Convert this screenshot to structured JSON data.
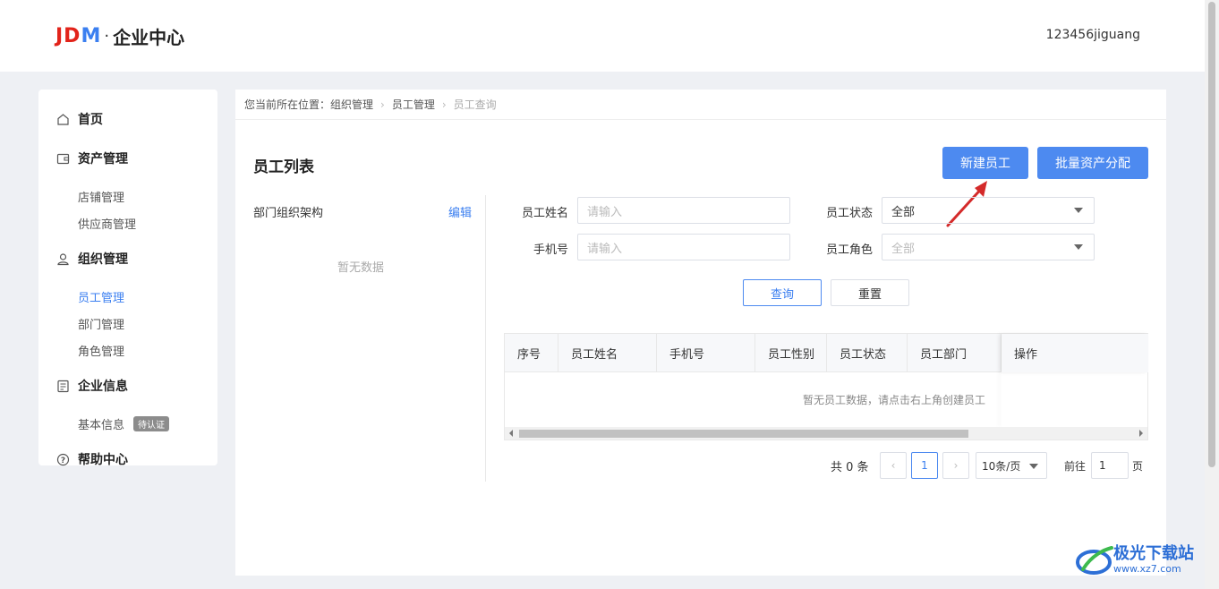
{
  "header": {
    "logo_jd": "JD",
    "logo_m": "M",
    "logo_dot": "·",
    "logo_text": "企业中心",
    "username": "123456jiguang"
  },
  "sidebar": {
    "home": "首页",
    "asset_mgmt": "资产管理",
    "store_mgmt": "店铺管理",
    "supplier_mgmt": "供应商管理",
    "org_mgmt": "组织管理",
    "employee_mgmt": "员工管理",
    "dept_mgmt": "部门管理",
    "role_mgmt": "角色管理",
    "company_info": "企业信息",
    "basic_info": "基本信息",
    "basic_info_badge": "待认证",
    "help_center": "帮助中心"
  },
  "breadcrumb": {
    "prefix": "您当前所在位置：",
    "level1": "组织管理",
    "level2": "员工管理",
    "level3": "员工查询"
  },
  "page": {
    "title": "员工列表",
    "new_employee_button": "新建员工",
    "batch_assign_button": "批量资产分配"
  },
  "dept_panel": {
    "title": "部门组织架构",
    "edit": "编辑",
    "empty": "暂无数据"
  },
  "filters": {
    "name_label": "员工姓名",
    "name_placeholder": "请输入",
    "phone_label": "手机号",
    "phone_placeholder": "请输入",
    "status_label": "员工状态",
    "status_value": "全部",
    "role_label": "员工角色",
    "role_placeholder": "全部",
    "query_button": "查询",
    "reset_button": "重置"
  },
  "table": {
    "columns": [
      "序号",
      "员工姓名",
      "手机号",
      "员工性别",
      "员工状态",
      "员工部门",
      "操作"
    ],
    "empty_text": "暂无员工数据，请点击右上角创建员工"
  },
  "pagination": {
    "total": "共 0 条",
    "current_page": "1",
    "page_size": "10条/页",
    "goto_label": "前往",
    "goto_value": "1",
    "page_suffix": "页"
  },
  "watermark": {
    "text": "极光下载站",
    "url": "www.xz7.com"
  },
  "colors": {
    "primary": "#4d8af0",
    "logo_red": "#e2231a",
    "annotation_arrow": "#d42a2a"
  }
}
